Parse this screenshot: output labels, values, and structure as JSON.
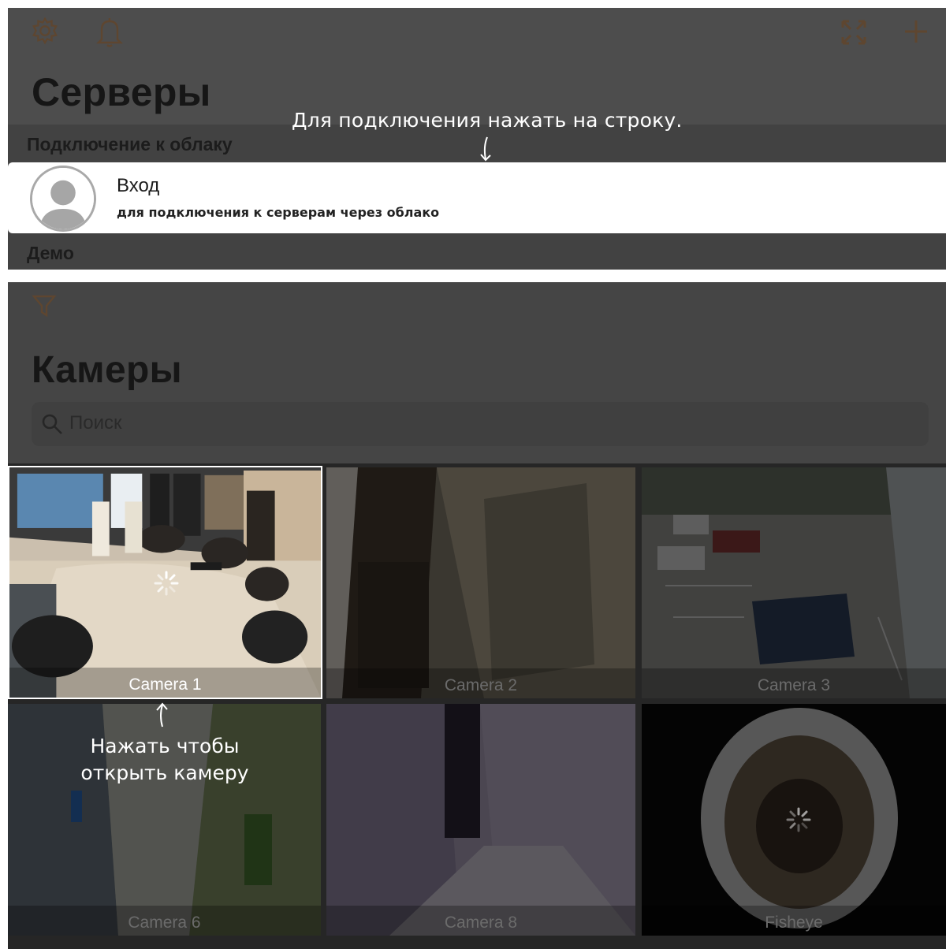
{
  "servers_screen": {
    "title": "Серверы",
    "icons": [
      "gear-icon",
      "bell-icon",
      "fullscreen-icon",
      "plus-icon"
    ],
    "accent_color": "#c8741e",
    "cloud_section": "Подключение к облаку",
    "login": {
      "title": "Вход",
      "subtitle": "для подключения к серверам через облако"
    },
    "demo_section": "Демо",
    "hint": "Для подключения нажать на строку."
  },
  "cameras_screen": {
    "title": "Камеры",
    "filter_icon": "filter-icon",
    "search": {
      "placeholder": "Поиск"
    },
    "cameras": [
      {
        "name": "Camera 1",
        "selected": true
      },
      {
        "name": "Camera 2",
        "selected": false
      },
      {
        "name": "Camera 3",
        "selected": false
      },
      {
        "name": "Camera 6",
        "selected": false
      },
      {
        "name": "Camera 8",
        "selected": false
      },
      {
        "name": "Fisheye",
        "selected": false
      }
    ],
    "hint": "Нажать чтобы открыть камеру"
  }
}
